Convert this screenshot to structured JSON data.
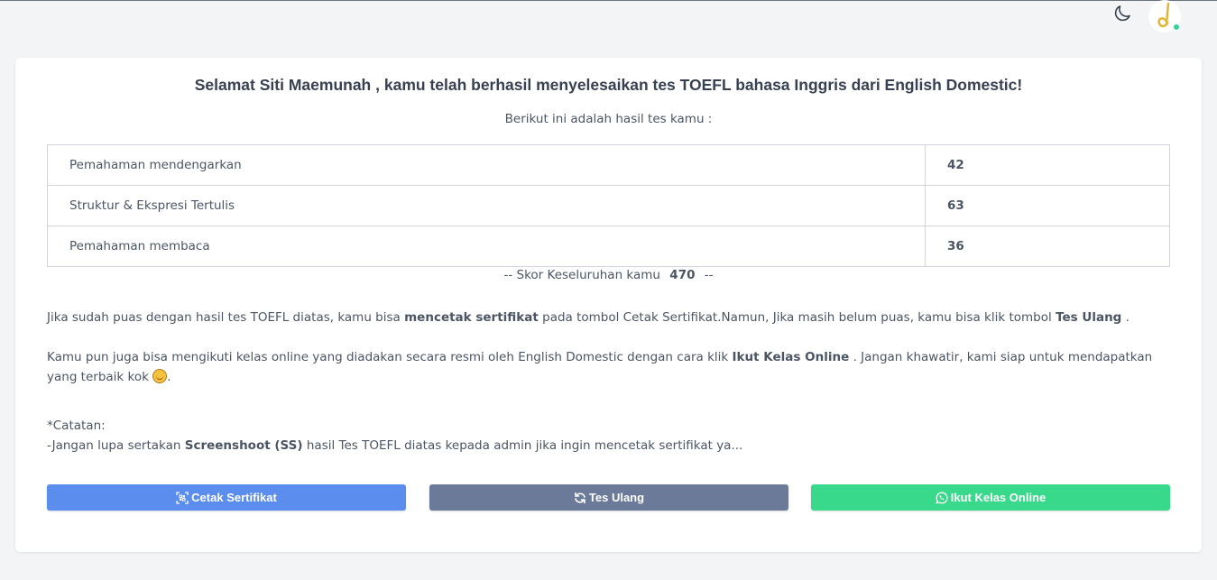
{
  "header": {
    "theme_toggle_icon": "moon-icon",
    "avatar_letter": "d",
    "colors": {
      "avatar_letter": "#e5b53a",
      "status_dot": "#34d399"
    }
  },
  "result": {
    "title_prefix": "Selamat",
    "user_name": "Siti Maemunah",
    "title_suffix": ", kamu telah berhasil menyelesaikan tes TOEFL bahasa Inggris dari English Domestic!",
    "subtitle": "Berikut ini adalah hasil tes kamu :",
    "scores": [
      {
        "label": "Pemahaman mendengarkan",
        "value": "42"
      },
      {
        "label": "Struktur & Ekspresi Tertulis",
        "value": "63"
      },
      {
        "label": "Pemahaman membaca",
        "value": "36"
      }
    ],
    "overall_prefix": "-- Skor Keseluruhan kamu",
    "overall_value": "470",
    "overall_suffix": "--"
  },
  "info": {
    "p1_a": "Jika sudah puas dengan hasil tes TOEFL diatas, kamu bisa",
    "p1_b": "mencetak sertifikat",
    "p1_c": "pada tombol Cetak Sertifikat.Namun, Jika masih belum puas, kamu bisa klik tombol",
    "p1_d": "Tes Ulang",
    "p1_e": ".",
    "p2_a": "Kamu pun juga bisa mengikuti kelas online yang diadakan secara resmi oleh English Domestic dengan cara klik",
    "p2_b": "Ikut Kelas Online",
    "p2_c": ". Jangan khawatir, kami siap untuk mendapatkan yang terbaik kok",
    "p2_d": ".",
    "note_title": "*Catatan:",
    "note_a": "-Jangan lupa sertakan",
    "note_b": "Screenshoot (SS)",
    "note_c": "hasil Tes TOEFL diatas kepada admin jika ingin mencetak sertifikat ya..."
  },
  "buttons": {
    "print_label": "Cetak Sertifikat",
    "retry_label": "Tes Ulang",
    "class_label": "Ikut Kelas Online",
    "colors": {
      "print": "#5a8dee",
      "retry": "#6b7a99",
      "class": "#38d98a"
    }
  }
}
